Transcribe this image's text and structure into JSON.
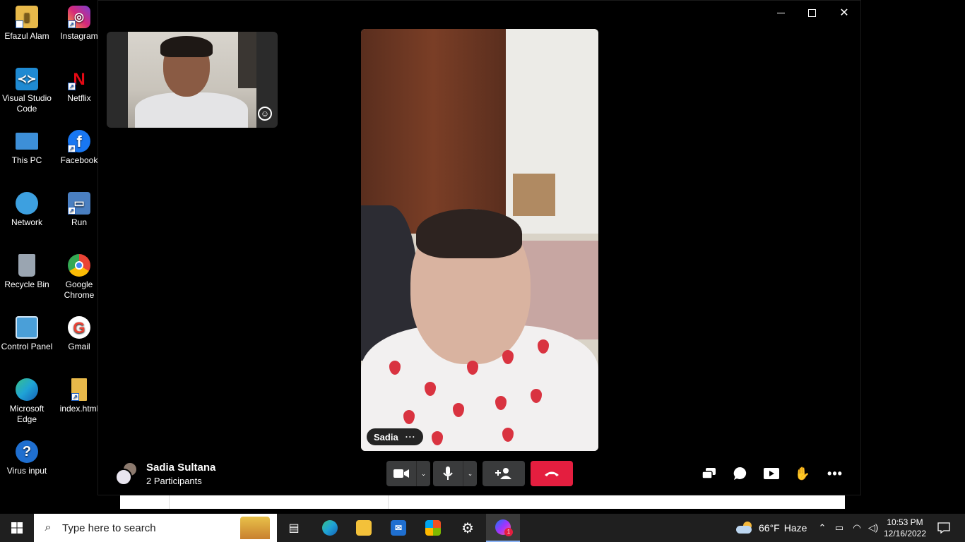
{
  "desktop": {
    "icons": [
      {
        "label": "Efazul Alam",
        "icon": "user-folder-icon",
        "color": "#e8b94a"
      },
      {
        "label": "Instagram",
        "icon": "instagram-icon",
        "color": "#d6287a"
      },
      {
        "label": "Visual Studio Code",
        "icon": "vscode-icon",
        "color": "#1f8ad2"
      },
      {
        "label": "Netflix",
        "icon": "netflix-icon",
        "color": "#e50914"
      },
      {
        "label": "This PC",
        "icon": "computer-icon",
        "color": "#3d8fd8"
      },
      {
        "label": "Facebook",
        "icon": "facebook-icon",
        "color": "#1877f2"
      },
      {
        "label": "Network",
        "icon": "network-icon",
        "color": "#3da0e0"
      },
      {
        "label": "Run",
        "icon": "run-icon",
        "color": "#4a7fc1"
      },
      {
        "label": "Recycle Bin",
        "icon": "recycle-bin-icon",
        "color": "#9aa5b1"
      },
      {
        "label": "Google Chrome",
        "icon": "chrome-icon",
        "color": "#34a853"
      },
      {
        "label": "Control Panel",
        "icon": "control-panel-icon",
        "color": "#4a9fd8"
      },
      {
        "label": "Gmail",
        "icon": "gmail-icon",
        "color": "#ea4335"
      },
      {
        "label": "Microsoft Edge",
        "icon": "edge-icon",
        "color": "#1fa3d6"
      },
      {
        "label": "index.html",
        "icon": "html-file-icon",
        "color": "#e8b94a"
      },
      {
        "label": "Virus input",
        "icon": "help-icon",
        "color": "#1f6fd0"
      }
    ]
  },
  "call": {
    "remote_name": "Sadia",
    "remote_more": "···",
    "caller_name": "Sadia Sultana",
    "participants": "2 Participants",
    "end_call_color": "#e41e3f",
    "button_color": "#3a3b3c"
  },
  "taskbar": {
    "search_placeholder": "Type here to search",
    "weather_temp": "66°F",
    "weather_desc": "Haze",
    "time": "10:53 PM",
    "date": "12/16/2022",
    "messenger_badge": "1"
  }
}
